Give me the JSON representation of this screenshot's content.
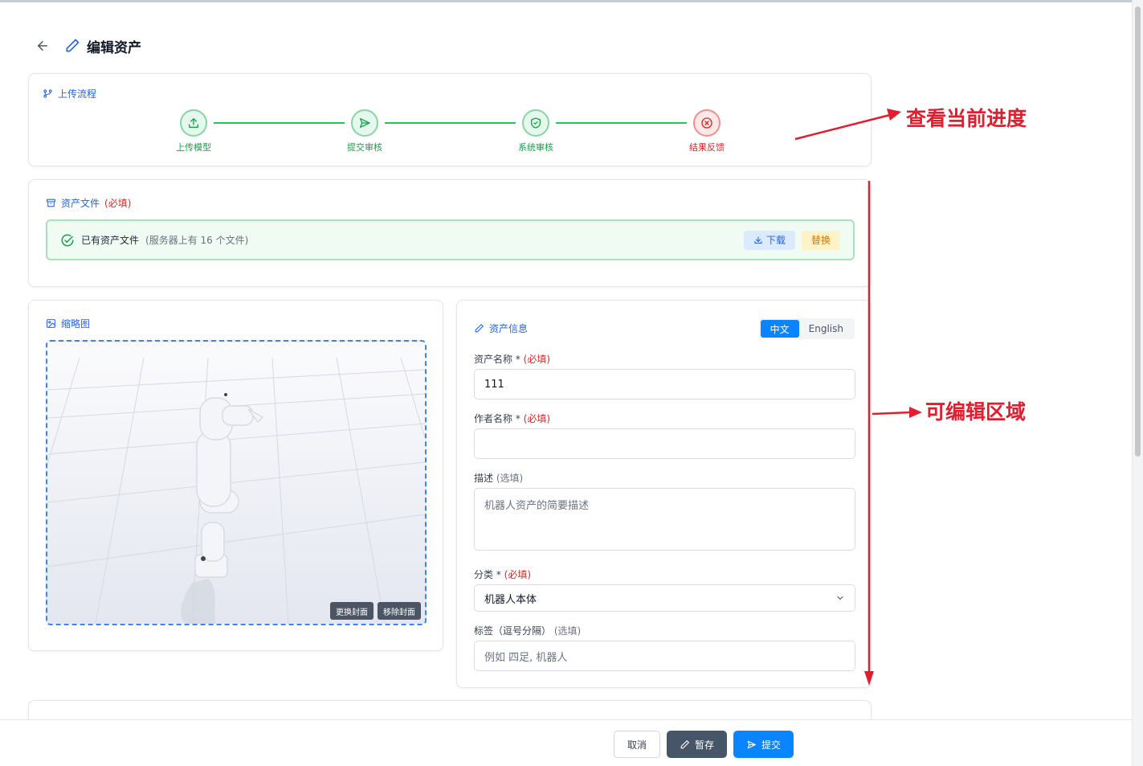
{
  "page": {
    "title": "编辑资产"
  },
  "progress": {
    "title": "上传流程",
    "steps": [
      {
        "label": "上传模型",
        "status": "done",
        "icon": "upload-icon"
      },
      {
        "label": "提交审核",
        "status": "done",
        "icon": "send-icon"
      },
      {
        "label": "系统审核",
        "status": "done",
        "icon": "shield-check-icon"
      },
      {
        "label": "结果反馈",
        "status": "error",
        "icon": "x-circle-icon"
      }
    ]
  },
  "asset_file": {
    "title": "资产文件",
    "required": "(必填)",
    "status_text": "已有资产文件",
    "status_detail": "(服务器上有 16 个文件)",
    "download_label": "下载",
    "replace_label": "替换"
  },
  "thumbnail": {
    "title": "缩略图",
    "change_label": "更换封面",
    "remove_label": "移除封面"
  },
  "asset_info": {
    "title": "资产信息",
    "lang_zh": "中文",
    "lang_en": "English",
    "name_label": "资产名称 *",
    "name_req": "(必填)",
    "name_value": "111",
    "author_label": "作者名称 *",
    "author_req": "(必填)",
    "author_value": "",
    "desc_label": "描述",
    "desc_hint": "(选填)",
    "desc_placeholder": "机器人资产的简要描述",
    "category_label": "分类 *",
    "category_req": "(必填)",
    "category_value": "机器人本体",
    "tags_label": "标签（逗号分隔）",
    "tags_hint": "(选填)",
    "tags_placeholder": "例如 四足, 机器人"
  },
  "footer": {
    "cancel_label": "取消",
    "draft_label": "暂存",
    "submit_label": "提交"
  },
  "annotations": {
    "progress_note": "查看当前进度",
    "editable_note": "可编辑区域",
    "color": "#e11d2e"
  },
  "colors": {
    "primary": "#0a84ff",
    "success": "#22c55e",
    "error": "#dc2626",
    "accent_text": "#2563eb"
  }
}
